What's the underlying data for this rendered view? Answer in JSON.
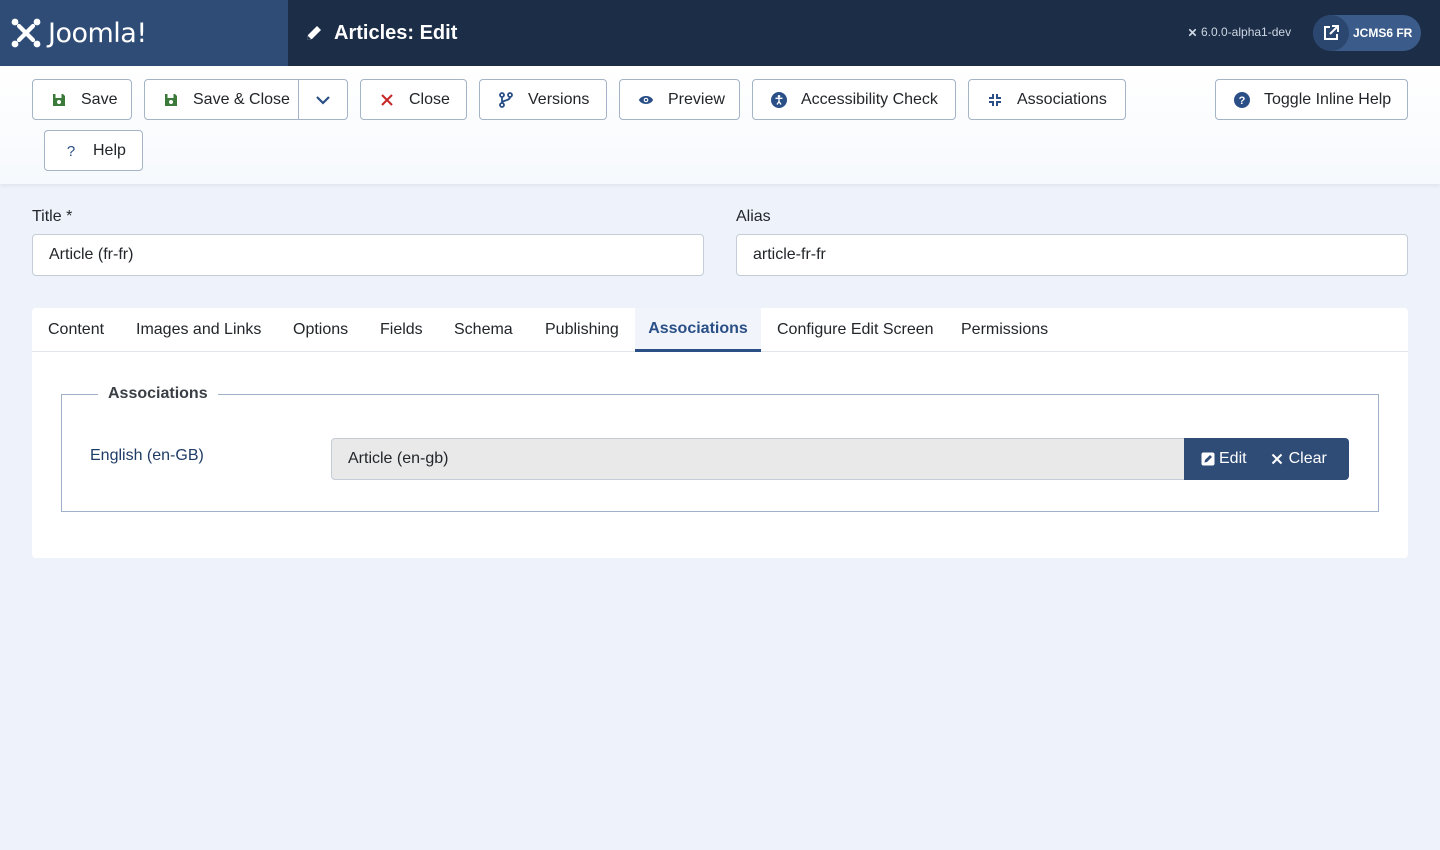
{
  "header": {
    "brand_name": "Joomla!",
    "page_title": "Articles: Edit",
    "version": "6.0.0-alpha1-dev",
    "site_label": "JCMS6 FR",
    "icons": {
      "title": "pencil-icon",
      "version": "joomla-mini-icon",
      "site": "external-link-icon"
    }
  },
  "toolbar": {
    "save": "Save",
    "save_close": "Save & Close",
    "close": "Close",
    "versions": "Versions",
    "preview": "Preview",
    "accessibility_check": "Accessibility Check",
    "associations": "Associations",
    "toggle_inline_help": "Toggle Inline Help",
    "help": "Help"
  },
  "form": {
    "title_label": "Title *",
    "title_value": "Article (fr-fr)",
    "alias_label": "Alias",
    "alias_value": "article-fr-fr"
  },
  "tabs": [
    {
      "label": "Content"
    },
    {
      "label": "Images and Links"
    },
    {
      "label": "Options"
    },
    {
      "label": "Fields"
    },
    {
      "label": "Schema"
    },
    {
      "label": "Publishing"
    },
    {
      "label": "Associations",
      "active": true
    },
    {
      "label": "Configure Edit Screen"
    },
    {
      "label": "Permissions"
    }
  ],
  "associations_panel": {
    "legend": "Associations",
    "language_label": "English (en-GB)",
    "associated_article": "Article (en-gb)",
    "edit_label": "Edit",
    "clear_label": "Clear"
  },
  "colors": {
    "header_bg": "#1c2d47",
    "brand_bg": "#2f4c77",
    "accent": "#2a4f86",
    "save_icon": "#3b7a3a",
    "close_icon": "#c52827",
    "page_bg": "#eef3fb"
  }
}
